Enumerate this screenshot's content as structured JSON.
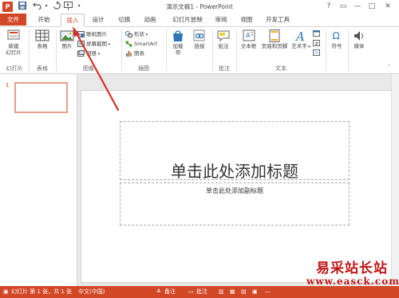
{
  "window": {
    "title": "演示文稿1 - PowerPoint",
    "app_logo": "P",
    "controls": {
      "help": "?",
      "ribbon_display": "▭",
      "minimize": "—",
      "restore": "□",
      "close": "✕"
    },
    "qat": {
      "save": "💾",
      "undo": "↶",
      "redo": "↻",
      "from_beginning": "▣"
    }
  },
  "tabs": [
    {
      "label": "文件"
    },
    {
      "label": "开始"
    },
    {
      "label": "插入"
    },
    {
      "label": "设计"
    },
    {
      "label": "切换"
    },
    {
      "label": "动画"
    },
    {
      "label": "幻灯片放映"
    },
    {
      "label": "审阅"
    },
    {
      "label": "视图"
    },
    {
      "label": "开发工具"
    }
  ],
  "ribbon": {
    "groups": {
      "slides": "幻灯片",
      "tables": "表格",
      "images": "图像",
      "illustrations": "插图",
      "comments": "批注",
      "text": "文本"
    },
    "buttons": {
      "new_slide": "新建",
      "new_slide_2": "幻灯片",
      "table": "表格",
      "pictures": "图片",
      "online_pictures": "联机图片",
      "screenshot": "屏幕截图",
      "album": "相册",
      "shapes": "形状",
      "smartart": "SmartArt",
      "chart": "图表",
      "addins": "加载",
      "addins_2": "项",
      "links": "链接",
      "comment": "批注",
      "textbox": "文本框",
      "header_footer": "页眉和页脚",
      "wordart": "艺术字",
      "symbols": "符号",
      "media": "媒体"
    }
  },
  "thumbnails": [
    {
      "number": "1"
    }
  ],
  "slide": {
    "title_placeholder": "单击此处添加标题",
    "subtitle_placeholder": "单击此处添加副标题"
  },
  "statusbar": {
    "slide_info": "幻灯片 第 1 张，共 1 张",
    "language": "中文(中国)",
    "notes": "备注",
    "comments": "批注",
    "zoom": "—"
  },
  "watermark": {
    "title": "易采站长站",
    "url": "www.easck.com"
  },
  "colors": {
    "accent": "#d24726",
    "watermark": "#c01818",
    "arrow": "#d8312a"
  }
}
